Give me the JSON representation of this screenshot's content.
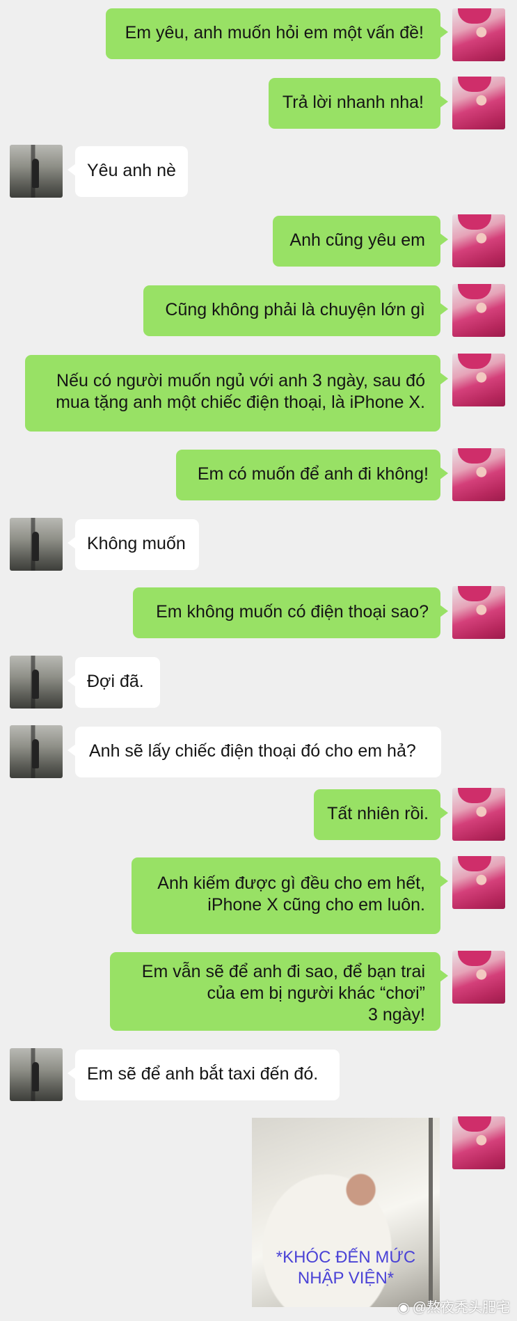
{
  "messages": [
    {
      "from": "me",
      "lines": [
        "Em yêu, anh muốn hỏi em một vấn đề!"
      ]
    },
    {
      "from": "me",
      "lines": [
        "Trả lời nhanh nha!"
      ]
    },
    {
      "from": "her",
      "lines": [
        "Yêu anh nè"
      ]
    },
    {
      "from": "me",
      "lines": [
        "Anh cũng yêu em"
      ]
    },
    {
      "from": "me",
      "lines": [
        "Cũng không phải là chuyện lớn gì"
      ]
    },
    {
      "from": "me",
      "lines": [
        "Nếu có người muốn ngủ với anh 3 ngày, sau đó",
        "mua tặng anh một chiếc điện thoại, là iPhone X."
      ]
    },
    {
      "from": "me",
      "lines": [
        "Em có muốn để anh đi không!"
      ]
    },
    {
      "from": "her",
      "lines": [
        "Không muốn"
      ]
    },
    {
      "from": "me",
      "lines": [
        "Em không muốn có điện thoại sao?"
      ]
    },
    {
      "from": "her",
      "lines": [
        "Đợi đã."
      ]
    },
    {
      "from": "her",
      "lines": [
        "Anh sẽ lấy chiếc điện thoại đó cho em hả?"
      ]
    },
    {
      "from": "me",
      "lines": [
        "Tất nhiên rồi."
      ]
    },
    {
      "from": "me",
      "lines": [
        "Anh kiếm được gì đều cho em hết,",
        "iPhone X cũng cho em luôn."
      ]
    },
    {
      "from": "me",
      "lines": [
        "Em vẫn sẽ để anh đi sao, để bạn trai",
        "của em bị người khác “chơi”",
        "3 ngày!"
      ]
    },
    {
      "from": "her",
      "lines": [
        "Em sẽ để anh bắt taxi đến đó."
      ]
    }
  ],
  "photo": {
    "caption_lines": [
      "*KHÓC ĐẾN MỨC",
      "NHẬP VIỆN*"
    ]
  },
  "watermark": {
    "icon": "weibo-icon",
    "text": "@熬夜秃头肥宅"
  },
  "colors": {
    "me_bubble": "#98e165",
    "her_bubble": "#ffffff",
    "background": "#efefef",
    "caption": "#4a42d6"
  }
}
